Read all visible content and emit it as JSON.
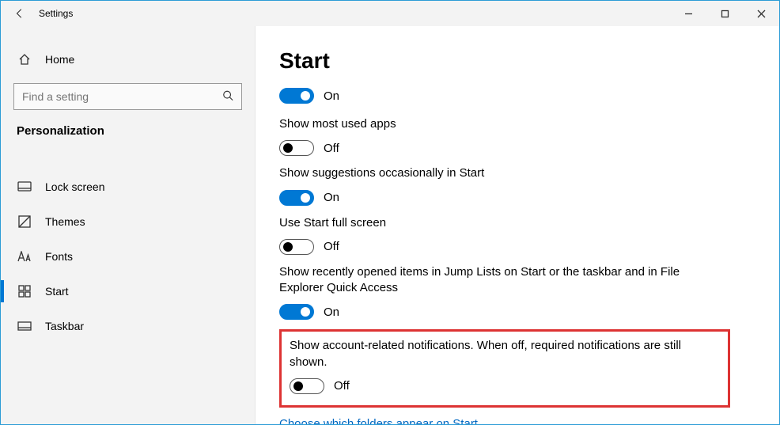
{
  "titlebar": {
    "app_title": "Settings"
  },
  "sidebar": {
    "home_label": "Home",
    "search_placeholder": "Find a setting",
    "section_label": "Personalization",
    "items": [
      {
        "label": "Lock screen",
        "selected": false
      },
      {
        "label": "Themes",
        "selected": false
      },
      {
        "label": "Fonts",
        "selected": false
      },
      {
        "label": "Start",
        "selected": true
      },
      {
        "label": "Taskbar",
        "selected": false
      }
    ]
  },
  "content": {
    "heading": "Start",
    "toggle_on_text": "On",
    "toggle_off_text": "Off",
    "settings": [
      {
        "label": "",
        "state": "on"
      },
      {
        "label": "Show most used apps",
        "state": "off"
      },
      {
        "label": "Show suggestions occasionally in Start",
        "state": "on"
      },
      {
        "label": "Use Start full screen",
        "state": "off"
      },
      {
        "label": "Show recently opened items in Jump Lists on Start or the taskbar and in File Explorer Quick Access",
        "state": "on"
      },
      {
        "label": "Show account-related notifications. When off, required notifications are still shown.",
        "state": "off"
      }
    ],
    "link_label": "Choose which folders appear on Start"
  },
  "colors": {
    "accent": "#0078d4",
    "highlight_border": "#d33"
  }
}
